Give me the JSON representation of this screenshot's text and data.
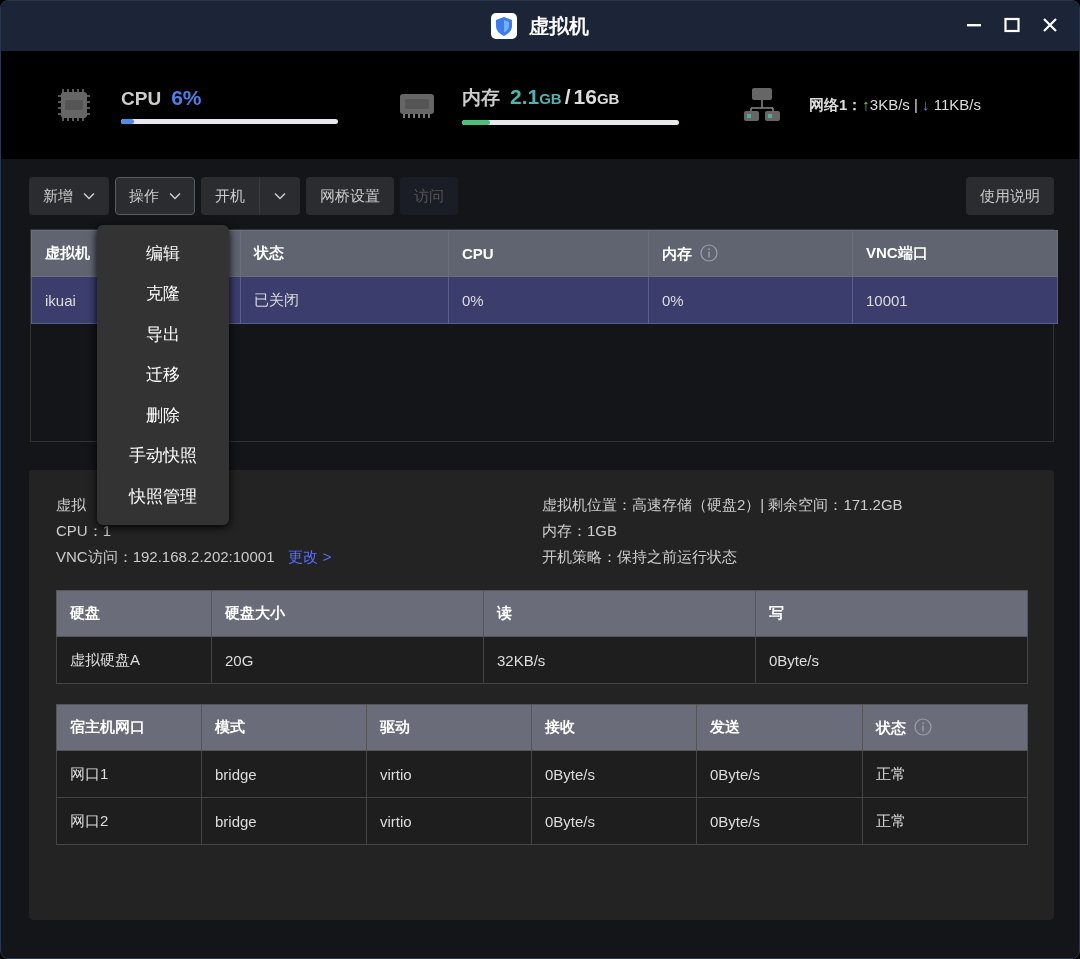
{
  "window": {
    "title": "虚拟机"
  },
  "stats": {
    "cpu": {
      "label": "CPU",
      "value": "6%",
      "level": 0.06
    },
    "memory": {
      "label": "内存",
      "used": "2.1",
      "used_unit": "GB",
      "separator": "/",
      "total": "16",
      "total_unit": "GB",
      "level": 0.13
    },
    "network": {
      "label": "网络1：",
      "up_arrow": "↑",
      "up": "3KB/s",
      "separator": "|",
      "down_arrow": "↓",
      "down": "11KB/s"
    }
  },
  "toolbar": [
    {
      "kind": "dropdown",
      "label": "新增",
      "open": false
    },
    {
      "kind": "dropdown",
      "label": "操作",
      "open": true
    },
    {
      "kind": "split",
      "label": "开机",
      "open": false
    },
    {
      "kind": "button",
      "label": "网桥设置",
      "disabled": false
    },
    {
      "kind": "button",
      "label": "访问",
      "disabled": true
    }
  ],
  "help_button": "使用说明",
  "menu": {
    "items": [
      "编辑",
      "克隆",
      "导出",
      "迁移",
      "删除",
      "手动快照",
      "快照管理"
    ]
  },
  "vm_table": {
    "columns": [
      {
        "label": "虚拟机",
        "info": false
      },
      {
        "label": "状态",
        "info": false
      },
      {
        "label": "CPU",
        "info": false
      },
      {
        "label": "内存",
        "info": true
      },
      {
        "label": "VNC端口",
        "info": false
      }
    ],
    "rows": [
      {
        "cells": [
          "ikuai",
          "已关闭",
          "0%",
          "0%",
          "10001"
        ],
        "selected": true
      }
    ]
  },
  "details": {
    "left": [
      {
        "text": "虚拟"
      },
      {
        "text": "CPU：1"
      },
      {
        "text": "VNC访问：192.168.2.202:10001",
        "link": "更改 >"
      }
    ],
    "right": [
      {
        "text": "虚拟机位置：高速存储（硬盘2）| 剩余空间：171.2GB"
      },
      {
        "text": "内存：1GB"
      },
      {
        "text": "开机策略：保持之前运行状态"
      }
    ]
  },
  "disk_table": {
    "columns": [
      {
        "label": "硬盘",
        "info": false
      },
      {
        "label": "硬盘大小",
        "info": false
      },
      {
        "label": "读",
        "info": false
      },
      {
        "label": "写",
        "info": false
      }
    ],
    "rows": [
      {
        "cells": [
          "虚拟硬盘A",
          "20G",
          "32KB/s",
          "0Byte/s"
        ],
        "selected": false
      }
    ]
  },
  "network_table": {
    "columns": [
      {
        "label": "宿主机网口",
        "info": false
      },
      {
        "label": "模式",
        "info": false
      },
      {
        "label": "驱动",
        "info": false
      },
      {
        "label": "接收",
        "info": false
      },
      {
        "label": "发送",
        "info": false
      },
      {
        "label": "状态",
        "info": true
      }
    ],
    "rows": [
      {
        "cells": [
          "网口1",
          "bridge",
          "virtio",
          "0Byte/s",
          "0Byte/s",
          "正常"
        ],
        "selected": false
      },
      {
        "cells": [
          "网口2",
          "bridge",
          "virtio",
          "0Byte/s",
          "0Byte/s",
          "正常"
        ],
        "selected": false
      }
    ]
  }
}
